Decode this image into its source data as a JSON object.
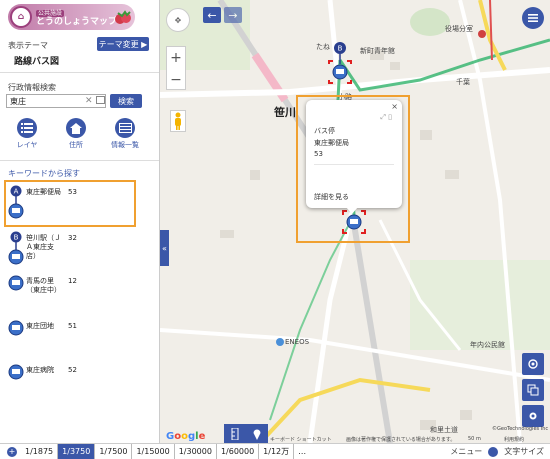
{
  "logo": {
    "tag": "公共施設",
    "title": "とうのしょうマップ"
  },
  "theme": {
    "label": "表示テーマ",
    "name": "路線バス図",
    "change_button": "テーマ変更 ▶"
  },
  "admin_search": {
    "label": "行政情報検索",
    "value": "東庄",
    "placeholder": "",
    "button": "検索"
  },
  "tools": [
    {
      "label": "レイヤ",
      "icon": "list-icon"
    },
    {
      "label": "住所",
      "icon": "home-icon"
    },
    {
      "label": "情報一覧",
      "icon": "table-icon"
    }
  ],
  "keyword": {
    "label": "キーワードから探す"
  },
  "results": [
    {
      "name": "東庄郵便局",
      "count": "53",
      "marker": "A"
    },
    {
      "name": "笹川駅（ＪＡ東庄支店）",
      "count": "32",
      "marker": "B"
    },
    {
      "name": "青馬の里（東庄中）",
      "count": "12",
      "marker": ""
    },
    {
      "name": "東庄団地",
      "count": "51",
      "marker": ""
    },
    {
      "name": "東庄病院",
      "count": "52",
      "marker": ""
    }
  ],
  "map": {
    "labels": {
      "town": "笹川",
      "shinmachi": "新町青年館",
      "yakuba": "役場分室",
      "chiba": "千葉",
      "nenkai": "年内公民館",
      "eneos": "ENEOS",
      "tana": "たね",
      "koji": "小路"
    },
    "popup": {
      "title": "バス停",
      "name": "東庄郵便局",
      "number": "53",
      "detail_link": "詳細を見る",
      "close": "×"
    },
    "collapse": "«",
    "attribution": {
      "shortcuts": "キーボード ショートカット",
      "imagery": "画像は著作権で保護されている場合があります。",
      "scale": "50 m",
      "terms": "利用規約",
      "geo": "©GeoTechnologies Inc",
      "town_label": "和里土道"
    }
  },
  "scalebar": {
    "items": [
      "1/1875",
      "1/3750",
      "1/7500",
      "1/15000",
      "1/30000",
      "1/60000",
      "1/12万",
      "…"
    ],
    "active_index": 1,
    "menu": "メニュー",
    "text_size": "文字サイズ"
  },
  "colors": {
    "accent": "#3b57a8",
    "highlight": "#f0a030",
    "route": "#2fb36a",
    "road": "#f6d95a"
  }
}
